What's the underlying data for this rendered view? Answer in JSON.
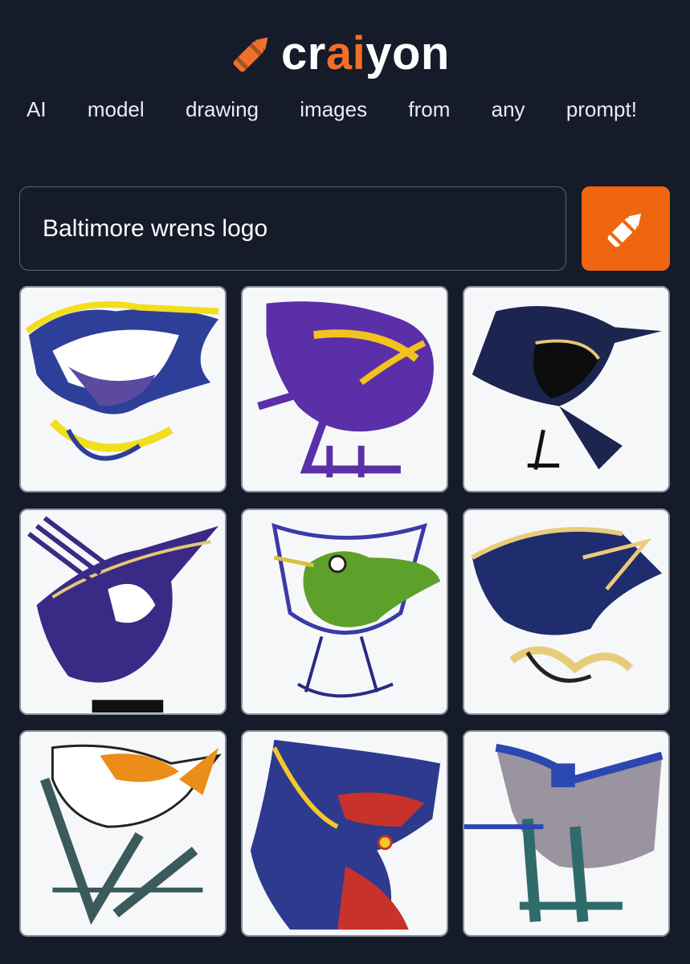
{
  "brand": {
    "name_prefix": "cr",
    "name_highlight": "ai",
    "name_suffix": "yon",
    "accent_color": "#f0702a"
  },
  "tagline": [
    "AI",
    "model",
    "drawing",
    "images",
    "from",
    "any",
    "prompt!"
  ],
  "prompt": {
    "value": "Baltimore wrens logo"
  },
  "draw_button": {
    "icon": "crayon-icon",
    "color": "#f0650f"
  },
  "results": [
    {
      "name": "result-image-1",
      "palette": [
        "#f2de1c",
        "#2e3f9a",
        "#5b4aa0"
      ]
    },
    {
      "name": "result-image-2",
      "palette": [
        "#5a2fa8",
        "#f3c21f",
        "#ffffff"
      ]
    },
    {
      "name": "result-image-3",
      "palette": [
        "#1c2450",
        "#e2c878",
        "#ffffff"
      ]
    },
    {
      "name": "result-image-4",
      "palette": [
        "#3a2a86",
        "#e3c878",
        "#ffffff"
      ]
    },
    {
      "name": "result-image-5",
      "palette": [
        "#5da02a",
        "#3a3aa8",
        "#ffffff"
      ]
    },
    {
      "name": "result-image-6",
      "palette": [
        "#1f2c6e",
        "#e8cc7a",
        "#ffffff"
      ]
    },
    {
      "name": "result-image-7",
      "palette": [
        "#eb8d18",
        "#3b5a5c",
        "#ffffff"
      ]
    },
    {
      "name": "result-image-8",
      "palette": [
        "#2d3a8e",
        "#c7322a",
        "#f2c82a"
      ]
    },
    {
      "name": "result-image-9",
      "palette": [
        "#2b48b0",
        "#9a93a0",
        "#2e6b6a"
      ]
    }
  ]
}
